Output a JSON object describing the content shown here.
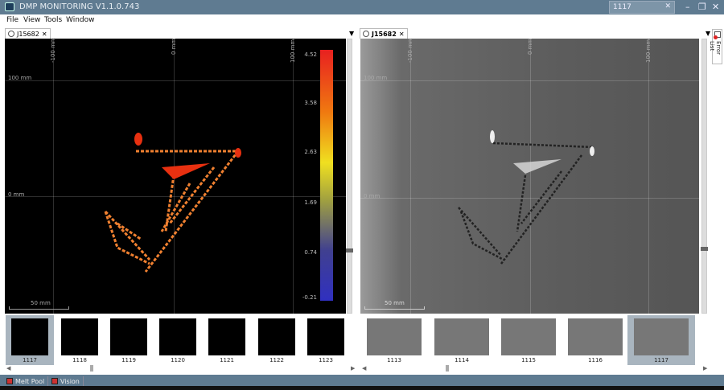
{
  "window": {
    "title": "DMP MONITORING V1.1.0.743",
    "search_value": "1117"
  },
  "menu": [
    "File",
    "View",
    "Tools",
    "Window"
  ],
  "left_panel": {
    "tab": "J15682",
    "x_axis_labels": [
      "-100 mm",
      "0 mm",
      "100 mm"
    ],
    "y_axis_labels": [
      "100 mm",
      "0 mm"
    ],
    "scale_bar": "50 mm",
    "colorbar": {
      "labels": [
        "4.52",
        "3.58",
        "2.63",
        "1.69",
        "0.74",
        "-0.21"
      ],
      "colors": [
        "#e82020",
        "#f07a10",
        "#f0e020",
        "#a0a040",
        "#404090",
        "#3030c0"
      ]
    },
    "thumbnails": [
      "1117",
      "1118",
      "1119",
      "1120",
      "1121",
      "1122",
      "1123"
    ],
    "selected": "1117"
  },
  "right_panel": {
    "tab": "J15682",
    "x_axis_labels": [
      "-100 mm",
      "0 mm",
      "100 mm"
    ],
    "y_axis_labels": [
      "100 mm",
      "0 mm"
    ],
    "scale_bar": "50 mm",
    "thumbnails": [
      "1113",
      "1114",
      "1115",
      "1116",
      "1117"
    ],
    "selected": "1117"
  },
  "side_panel": {
    "label": "Error List"
  },
  "bottom_tabs": [
    "Melt Pool",
    "Vision"
  ]
}
